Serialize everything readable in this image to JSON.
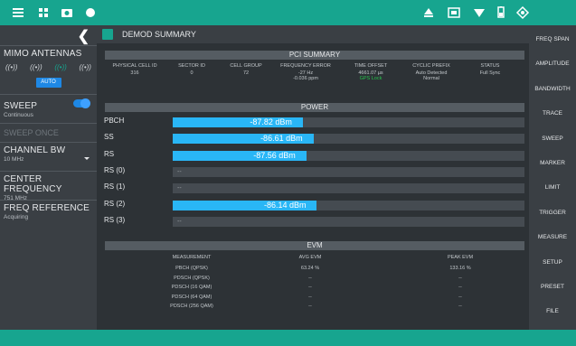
{
  "topbar": {
    "left_icons": [
      "menu-icon",
      "grid-icon",
      "camera-icon",
      "status-dot-icon"
    ],
    "right_icons": [
      "upload-icon",
      "screen-icon",
      "wifi-icon",
      "battery-icon",
      "gps-icon"
    ],
    "color": "#17a58f"
  },
  "left_panel": {
    "mimo": {
      "title": "MIMO ANTENNAS",
      "antennas": [
        "((•))",
        "((•))",
        "((•))",
        "((•))"
      ],
      "auto_label": "AUTO"
    },
    "sweep": {
      "title": "SWEEP",
      "sub": "Continuous",
      "toggle": "on"
    },
    "sweep_once": "SWEEP ONCE",
    "channel_bw": {
      "title": "CHANNEL BW",
      "value": "10 MHz"
    },
    "center_freq": {
      "title": "CENTER FREQUENCY",
      "value": "751 MHz"
    },
    "freq_ref": {
      "title": "FREQ REFERENCE",
      "value": "Acquiring"
    }
  },
  "main": {
    "title": "DEMOD SUMMARY",
    "pci": {
      "header": "PCI SUMMARY",
      "columns": [
        {
          "label": "PHYSICAL CELL ID",
          "value": "316"
        },
        {
          "label": "SECTOR ID",
          "value": "0"
        },
        {
          "label": "CELL GROUP",
          "value": "72"
        },
        {
          "label": "FREQUENCY ERROR",
          "value": "-27 Hz",
          "value2": "-0.036 ppm"
        },
        {
          "label": "TIME OFFSET",
          "value": "4661.07 µs",
          "value2": "GPS Lock"
        },
        {
          "label": "CYCLIC PREFIX",
          "value": "Auto Detected",
          "value2": "Normal"
        },
        {
          "label": "STATUS",
          "value": "Full Sync"
        }
      ]
    },
    "power": {
      "header": "POWER",
      "rows": [
        {
          "label": "PBCH",
          "value": "-87.82 dBm",
          "fill": 0.37
        },
        {
          "label": "SS",
          "value": "-86.61 dBm",
          "fill": 0.4
        },
        {
          "label": "RS",
          "value": "-87.56 dBm",
          "fill": 0.38
        },
        {
          "label": "RS (0)",
          "value": "--",
          "fill": 0
        },
        {
          "label": "RS (1)",
          "value": "--",
          "fill": 0
        },
        {
          "label": "RS (2)",
          "value": "-86.14 dBm",
          "fill": 0.41
        },
        {
          "label": "RS (3)",
          "value": "--",
          "fill": 0
        }
      ]
    },
    "evm": {
      "header": "EVM",
      "col_headers": [
        "MEASUREMENT",
        "AVG EVM",
        "PEAK EVM"
      ],
      "rows": [
        {
          "m": "PBCH (QPSK)",
          "avg": "63.24 %",
          "peak": "133.16 %"
        },
        {
          "m": "PDSCH (QPSK)",
          "avg": "--",
          "peak": "--"
        },
        {
          "m": "PDSCH (16 QAM)",
          "avg": "--",
          "peak": "--"
        },
        {
          "m": "PDSCH (64 QAM)",
          "avg": "--",
          "peak": "--"
        },
        {
          "m": "PDSCH (256 QAM)",
          "avg": "--",
          "peak": "--"
        }
      ]
    }
  },
  "right_menu": [
    "FREQ SPAN",
    "AMPLITUDE",
    "BANDWIDTH",
    "TRACE",
    "SWEEP",
    "MARKER",
    "LIMIT",
    "TRIGGER",
    "MEASURE",
    "SETUP",
    "PRESET",
    "FILE"
  ]
}
